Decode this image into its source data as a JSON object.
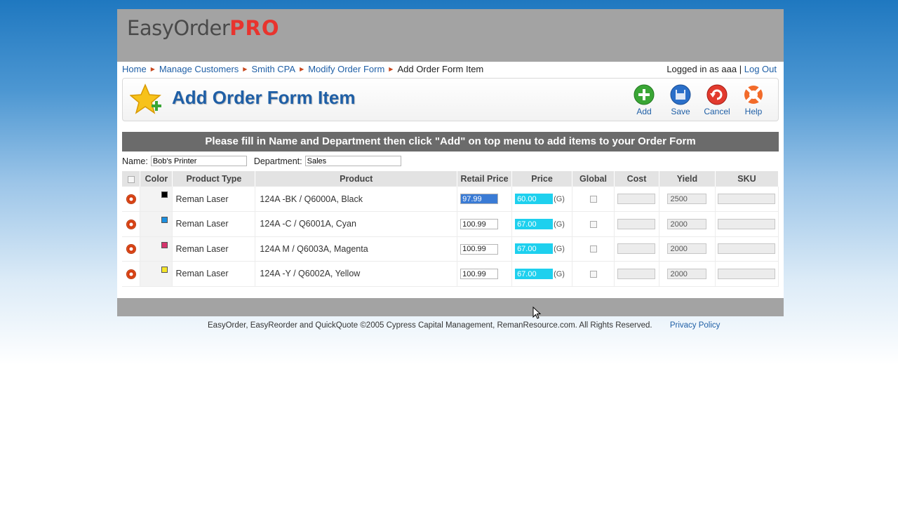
{
  "app": {
    "logo_easy": "EasyOrder",
    "logo_pro": "PRO"
  },
  "breadcrumb": [
    {
      "label": "Home"
    },
    {
      "label": "Manage Customers"
    },
    {
      "label": "Smith CPA"
    },
    {
      "label": "Modify Order Form"
    }
  ],
  "breadcrumb_current": "Add Order Form Item",
  "login": {
    "text": "Logged in as aaa",
    "sep": "|",
    "logout": "Log Out"
  },
  "page_title": "Add Order Form Item",
  "actions": {
    "add": "Add",
    "save": "Save",
    "cancel": "Cancel",
    "help": "Help"
  },
  "instruction": "Please fill in Name and Department then click \"Add\" on top menu to add items to your Order Form",
  "form": {
    "name_label": "Name:",
    "name_value": "Bob's Printer",
    "dept_label": "Department:",
    "dept_value": "Sales"
  },
  "table": {
    "headers": [
      "",
      "Color",
      "Product Type",
      "Product",
      "Retail Price",
      "Price",
      "Global",
      "Cost",
      "Yield",
      "SKU"
    ],
    "rows": [
      {
        "swatch": "#000000",
        "type": "Reman Laser",
        "product": "124A -BK / Q6000A, Black",
        "retail": "97.99",
        "price": "60.00",
        "g": "(G)",
        "yield": "2500"
      },
      {
        "swatch": "#1b8fe0",
        "type": "Reman Laser",
        "product": "124A -C / Q6001A, Cyan",
        "retail": "100.99",
        "price": "67.00",
        "g": "(G)",
        "yield": "2000"
      },
      {
        "swatch": "#d6336c",
        "type": "Reman Laser",
        "product": "124A M / Q6003A, Magenta",
        "retail": "100.99",
        "price": "67.00",
        "g": "(G)",
        "yield": "2000"
      },
      {
        "swatch": "#f5e52a",
        "type": "Reman Laser",
        "product": "124A -Y / Q6002A, Yellow",
        "retail": "100.99",
        "price": "67.00",
        "g": "(G)",
        "yield": "2000"
      }
    ]
  },
  "footer": {
    "copyright": "EasyOrder, EasyReorder and QuickQuote ©2005 Cypress Capital Management, RemanResource.com. All Rights Reserved.",
    "privacy": "Privacy Policy"
  }
}
